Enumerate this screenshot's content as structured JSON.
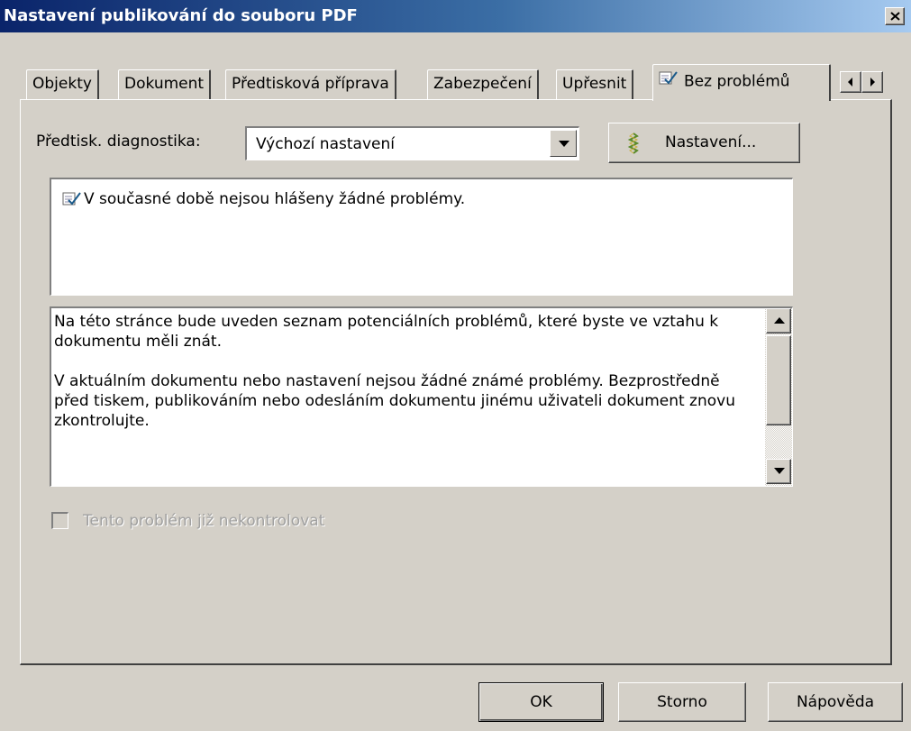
{
  "window": {
    "title": "Nastavení publikování do souboru PDF"
  },
  "tabs": [
    {
      "label": "Objekty"
    },
    {
      "label": "Dokument"
    },
    {
      "label": "Předtisková příprava"
    },
    {
      "label": "Zabezpečení"
    },
    {
      "label": "Upřesnit"
    },
    {
      "label": "Bez problémů",
      "active": true,
      "icon": "check-document-icon"
    }
  ],
  "preflight": {
    "label": "Předtisk. diagnostika:",
    "selected": "Výchozí nastavení",
    "settings_button": "Nastavení..."
  },
  "issues": {
    "items": [
      "V současné době nejsou hlášeny žádné problémy."
    ]
  },
  "description": {
    "paragraphs": [
      "Na této stránce bude uveden seznam potenciálních problémů, které byste ve vztahu k dokumentu měli znát.",
      "V aktuálním dokumentu nebo nastavení nejsou žádné známé problémy. Bezprostředně před tiskem, publikováním nebo odesláním dokumentu jinému uživateli dokument znovu zkontrolujte."
    ]
  },
  "checkbox": {
    "label": "Tento problém již nekontrolovat",
    "checked": false,
    "disabled": true
  },
  "buttons": {
    "ok": "OK",
    "cancel": "Storno",
    "help": "Nápověda"
  }
}
